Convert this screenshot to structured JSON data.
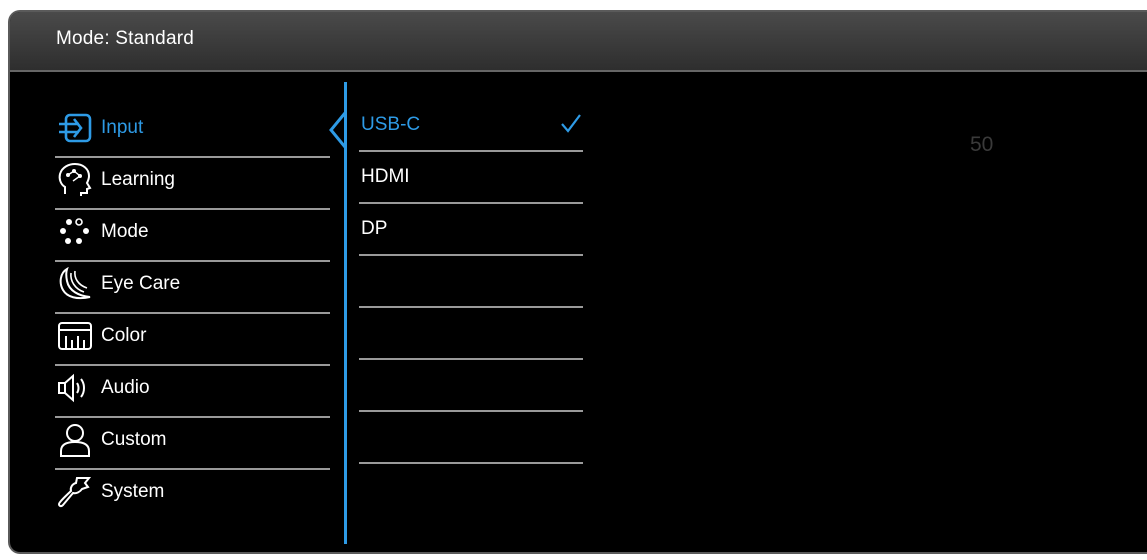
{
  "header": {
    "title": "Mode: Standard"
  },
  "menu": {
    "items": [
      {
        "label": "Input",
        "icon": "input-icon",
        "active": true
      },
      {
        "label": "Learning",
        "icon": "learning-icon"
      },
      {
        "label": "Mode",
        "icon": "mode-icon"
      },
      {
        "label": "Eye Care",
        "icon": "eye-care-icon"
      },
      {
        "label": "Color",
        "icon": "color-icon"
      },
      {
        "label": "Audio",
        "icon": "audio-icon"
      },
      {
        "label": "Custom",
        "icon": "custom-icon"
      },
      {
        "label": "System",
        "icon": "system-icon"
      }
    ]
  },
  "submenu": {
    "items": [
      {
        "label": "USB-C",
        "selected": true
      },
      {
        "label": "HDMI"
      },
      {
        "label": "DP"
      },
      {
        "label": ""
      },
      {
        "label": ""
      },
      {
        "label": ""
      },
      {
        "label": ""
      }
    ]
  },
  "value_display": "50",
  "colors": {
    "accent": "#2e9be6",
    "header_bg": "#3a3a3a",
    "background": "#000000",
    "dim_value": "#3a3a3a"
  }
}
